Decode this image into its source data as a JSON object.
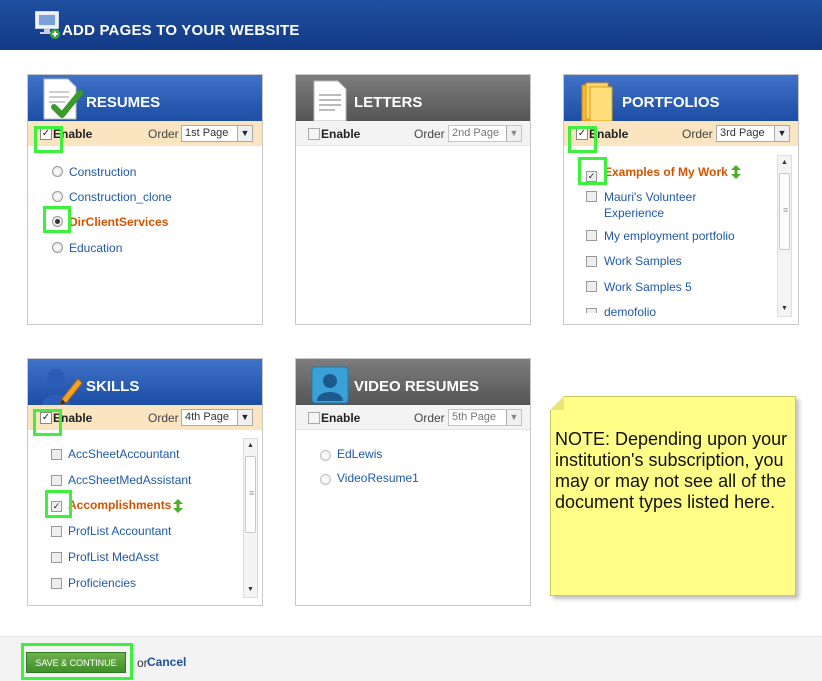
{
  "header": {
    "title": "ADD PAGES TO YOUR WEBSITE"
  },
  "enable_label": "Enable",
  "order_label": "Order",
  "panels": {
    "resumes": {
      "title": "RESUMES",
      "enabled": true,
      "order": "1st Page",
      "items": [
        "Construction",
        "Construction_clone",
        "DirClientServices",
        "Education"
      ],
      "selected": "DirClientServices"
    },
    "letters": {
      "title": "LETTERS",
      "enabled": false,
      "order": "2nd Page",
      "items": []
    },
    "portfolios": {
      "title": "PORTFOLIOS",
      "enabled": true,
      "order": "3rd Page",
      "items": [
        "Examples of My Work",
        "Mauri's Volunteer Experience",
        "My employment portfolio",
        "Work Samples",
        "Work Samples 5",
        "demofolio"
      ],
      "checked": [
        "Examples of My Work"
      ]
    },
    "skills": {
      "title": "SKILLS",
      "enabled": true,
      "order": "4th Page",
      "items": [
        "AccSheetAccountant",
        "AccSheetMedAssistant",
        "Accomplishments",
        "ProfList Accountant",
        "ProfList MedAsst",
        "Proficiencies"
      ],
      "checked": [
        "Accomplishments"
      ]
    },
    "video_resumes": {
      "title": "VIDEO RESUMES",
      "enabled": false,
      "order": "5th Page",
      "items": [
        "EdLewis",
        "VideoResume1"
      ]
    }
  },
  "note": {
    "text": "NOTE:  Depending upon your institution's subscription, you may or may not see all of the document types listed here."
  },
  "footer": {
    "save_label": "SAVE & CONTINUE",
    "or_text": "or",
    "cancel_label": "Cancel"
  },
  "colors": {
    "header_blue": "#1f4fa0",
    "selected_orange": "#d35400",
    "link_blue": "#1f5aa6",
    "highlight_green": "#3cf03c",
    "note_yellow": "#ffff88"
  },
  "icons": {
    "header": "monitor-plus-icon",
    "resumes": "document-check-icon",
    "letters": "document-lines-icon",
    "portfolios": "folder-icon",
    "skills": "person-pencil-icon",
    "video_resumes": "person-video-icon",
    "reorder": "up-down-arrow-icon"
  }
}
